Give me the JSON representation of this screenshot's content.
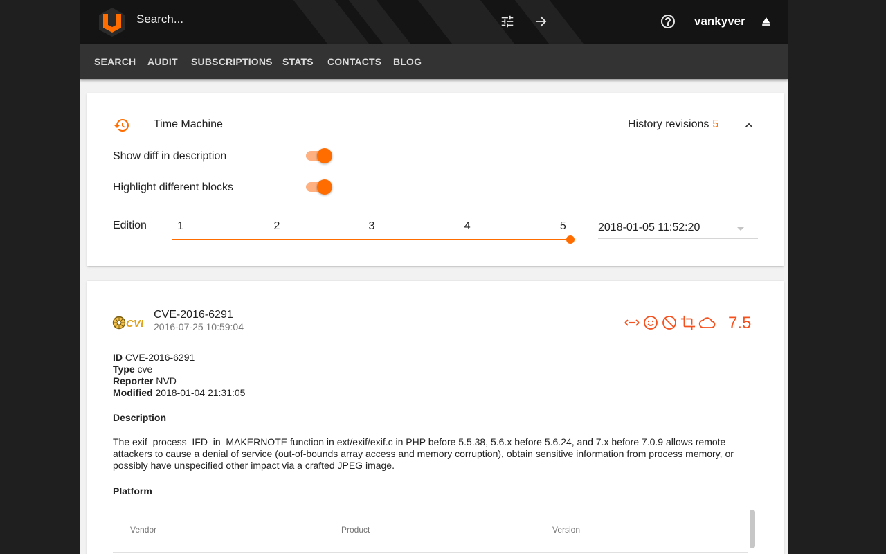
{
  "topbar": {
    "search_placeholder": "Search...",
    "username": "vankyver"
  },
  "nav": {
    "items": [
      "SEARCH",
      "AUDIT",
      "SUBSCRIPTIONS",
      "STATS",
      "CONTACTS",
      "BLOG"
    ]
  },
  "time_machine": {
    "title": "Time Machine",
    "history_label": "History revisions",
    "history_count": "5",
    "show_diff_label": "Show diff in description",
    "show_diff_on": true,
    "highlight_label": "Highlight different blocks",
    "highlight_on": true,
    "edition_label": "Edition",
    "editions": [
      "1",
      "2",
      "3",
      "4",
      "5"
    ],
    "selected_edition": "5",
    "revision_date": "2018-01-05 11:52:20"
  },
  "cve": {
    "logo_text": "CVE",
    "title": "CVE-2016-6291",
    "published": "2016-07-25 10:59:04",
    "score": "7.5",
    "flags": [
      "code-icon",
      "smile-icon",
      "block-icon",
      "crop-icon",
      "cloud-icon"
    ],
    "fields": {
      "id_label": "ID",
      "id": "CVE-2016-6291",
      "type_label": "Type",
      "type": "cve",
      "reporter_label": "Reporter",
      "reporter": "NVD",
      "modified_label": "Modified",
      "modified": "2018-01-04 21:31:05"
    },
    "description_title": "Description",
    "description": "The exif_process_IFD_in_MAKERNOTE function in ext/exif/exif.c in PHP before 5.5.38, 5.6.x before 5.6.24, and 7.x before 7.0.9 allows remote attackers to cause a denial of service (out-of-bounds array access and memory corruption), obtain sensitive information from process memory, or possibly have unspecified other impact via a crafted JPEG image.",
    "platform_title": "Platform",
    "platform_columns": [
      "Vendor",
      "Product",
      "Version"
    ]
  },
  "colors": {
    "accent": "#ff6d00",
    "score": "#f4511e",
    "topbar": "#141414",
    "navbar": "#333333"
  }
}
